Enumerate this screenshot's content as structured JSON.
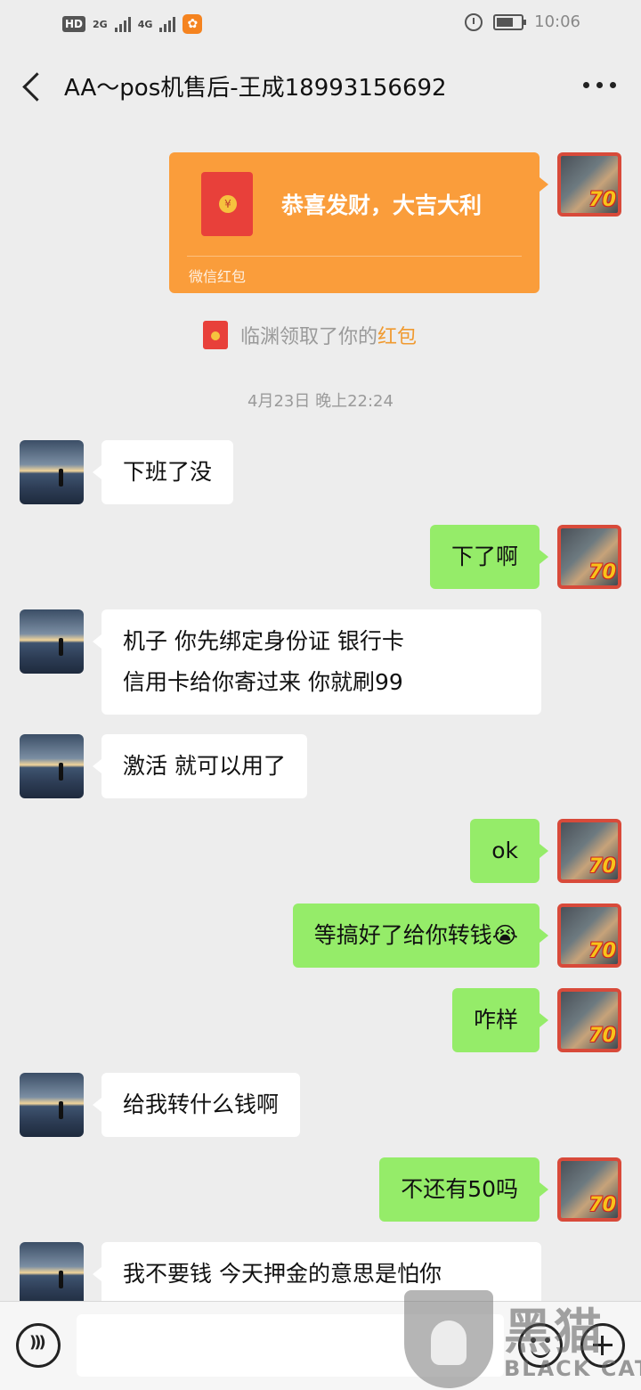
{
  "status_bar": {
    "hd": "HD",
    "net1": "2G",
    "net2": "4G",
    "time": "10:06"
  },
  "nav": {
    "title": "AA～pos机售后-王成18993156692"
  },
  "red_packet": {
    "greeting": "恭喜发财，大吉大利",
    "footer": "微信红包"
  },
  "system_notice": {
    "text": "临渊领取了你的",
    "highlight": "红包"
  },
  "timestamp": "4月23日 晚上22:24",
  "messages": [
    {
      "from": "other",
      "text": "下班了没"
    },
    {
      "from": "me",
      "text": "下了啊"
    },
    {
      "from": "other",
      "line1": "机子 你先绑定身份证  银行卡",
      "line2": "信用卡给你寄过来 你就刷99"
    },
    {
      "from": "other",
      "text": "激活 就可以用了"
    },
    {
      "from": "me",
      "text": "ok"
    },
    {
      "from": "me",
      "text": "等搞好了给你转钱",
      "emoji": "😭"
    },
    {
      "from": "me",
      "text": "咋样"
    },
    {
      "from": "other",
      "text": "给我转什么钱啊"
    },
    {
      "from": "me",
      "text": "不还有50吗"
    },
    {
      "from": "other",
      "text": "我不要钱  今天押金的意思是怕你"
    }
  ],
  "avatar_badge": "70",
  "input": {
    "placeholder": ""
  },
  "watermark": {
    "cn": "黑猫",
    "en": "BLACK CAT"
  },
  "icons": {
    "back": "chevron-left-icon",
    "more": "more-dots-icon",
    "voice": "voice-icon",
    "emoji": "emoji-icon",
    "plus": "plus-icon"
  },
  "colors": {
    "outgoing_bubble": "#95ec69",
    "incoming_bubble": "#ffffff",
    "red_packet": "#fa9d3b",
    "background": "#ededed"
  }
}
